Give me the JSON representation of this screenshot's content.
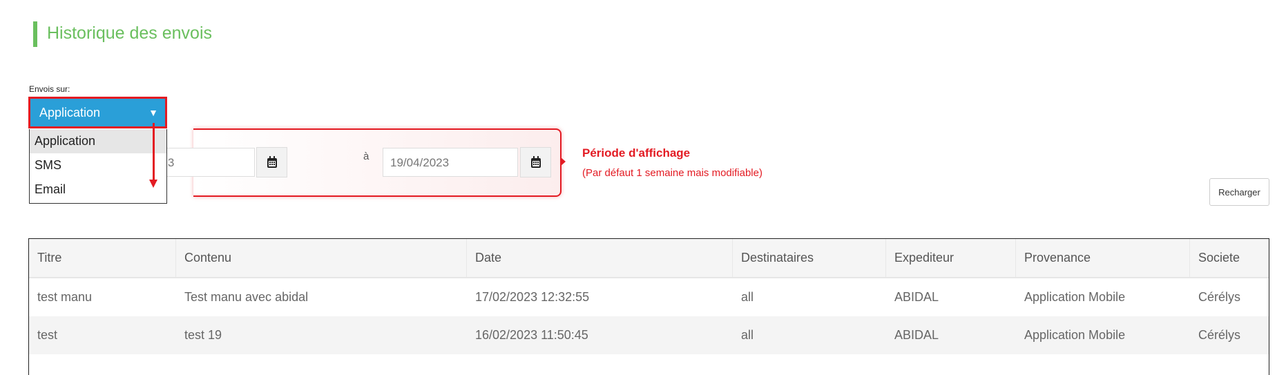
{
  "page": {
    "title": "Historique des envois"
  },
  "filter": {
    "label": "Envois sur:",
    "selected": "Application",
    "options": [
      "Application",
      "SMS",
      "Email"
    ]
  },
  "dates": {
    "from": "023",
    "separator": "à",
    "to": "19/04/2023"
  },
  "annotation": {
    "title": "Période d'affichage",
    "subtitle": "(Par défaut 1 semaine mais modifiable)"
  },
  "reload_label": "Recharger",
  "colors": {
    "accent": "#6abf5e",
    "select": "#2a9fd8",
    "annotation": "#e31b23"
  },
  "table": {
    "headers": [
      "Titre",
      "Contenu",
      "Date",
      "Destinataires",
      "Expediteur",
      "Provenance",
      "Societe"
    ],
    "rows": [
      [
        "test manu",
        "Test manu avec abidal",
        "17/02/2023 12:32:55",
        "all",
        "ABIDAL",
        "Application Mobile",
        "Cérélys"
      ],
      [
        "test",
        "test 19",
        "16/02/2023 11:50:45",
        "all",
        "ABIDAL",
        "Application Mobile",
        "Cérélys"
      ]
    ]
  }
}
